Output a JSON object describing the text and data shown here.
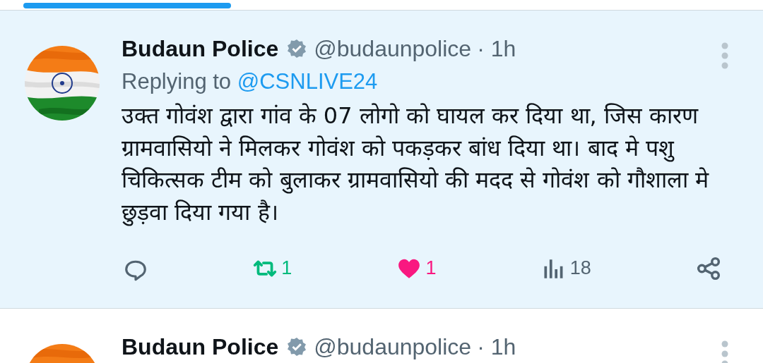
{
  "tweets": [
    {
      "name": "Budaun Police",
      "verified": true,
      "handle": "@budaunpolice",
      "time": "· 1h",
      "highlighted": true,
      "reply_prefix": "Replying to",
      "reply_to": "@CSNLIVE24",
      "text": "उक्त गोवंश द्वारा गांव के 07 लोगो को घायल कर दिया था, जिस कारण ग्रामवासियो ने मिलकर गोवंश को पकड़कर बांध दिया था। बाद मे पशु चिकित्सक टीम को बुलाकर ग्रामवासियो की मदद से गोवंश को गौशाला मे छुड़वा दिया गया है।",
      "actions": [
        {
          "kind": "reply"
        },
        {
          "kind": "retweet",
          "count": "1",
          "active": true
        },
        {
          "kind": "like",
          "count": "1",
          "active": true
        },
        {
          "kind": "views",
          "count": "18"
        },
        {
          "kind": "share"
        }
      ]
    },
    {
      "name": "Budaun Police",
      "verified": true,
      "handle": "@budaunpolice",
      "time": "· 1h",
      "highlighted": false
    }
  ]
}
